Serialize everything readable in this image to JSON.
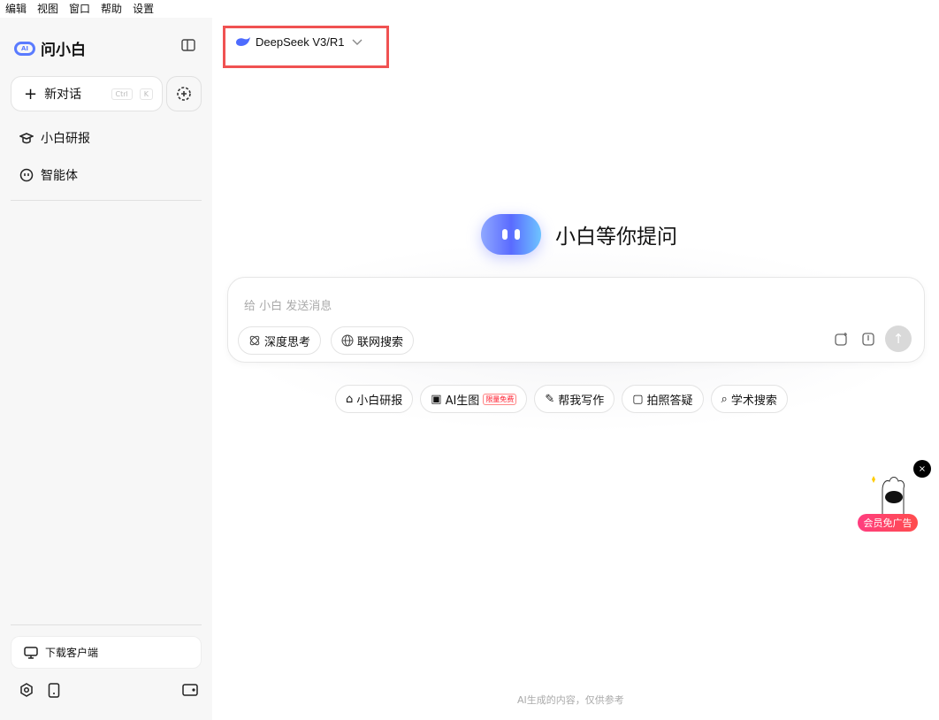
{
  "menu": [
    "编辑",
    "视图",
    "窗口",
    "帮助",
    "设置"
  ],
  "sidebar": {
    "app_name": "问小白",
    "logo_text": "AI",
    "new_chat": "新对话",
    "shortcut": [
      "Ctrl",
      "K"
    ],
    "items": [
      {
        "label": "小白研报"
      },
      {
        "label": "智能体"
      }
    ],
    "download": "下载客户端"
  },
  "model": {
    "name": "DeepSeek V3/R1"
  },
  "hero": {
    "title": "小白等你提问"
  },
  "composer": {
    "placeholder": "给 小白 发送消息",
    "deep_think": "深度思考",
    "web_search": "联网搜索",
    "send": "↑"
  },
  "tools": [
    {
      "label": "小白研报"
    },
    {
      "label": "AI生图",
      "badge": "限量免费"
    },
    {
      "label": "帮我写作"
    },
    {
      "label": "拍照答疑"
    },
    {
      "label": "学术搜索"
    }
  ],
  "ad": {
    "label": "会员免广告",
    "close": "×"
  },
  "footer": "AI生成的内容，仅供参考",
  "colors": {
    "accent": "#5a6bff",
    "highlight": "#f05252",
    "ad": "#ff3d6b"
  }
}
